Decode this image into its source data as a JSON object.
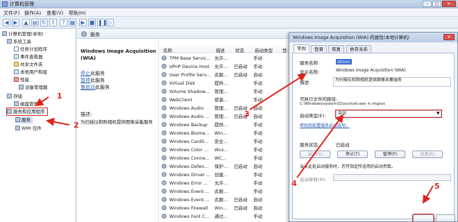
{
  "window": {
    "title": "计算机管理"
  },
  "menu": [
    "文件(F)",
    "操作(A)",
    "查看(V)",
    "帮助(H)"
  ],
  "tree": {
    "root": "计算机管理(本地)",
    "items": [
      "系统工具",
      "任务计划程序",
      "事件查看器",
      "共享文件夹",
      "本地用户和组",
      "性能",
      "设备管理器",
      "存储",
      "磁盘管理",
      "服务和应用程序",
      "服务",
      "WMI 控件"
    ]
  },
  "header": {
    "title": "服务"
  },
  "detail": {
    "service_name": "Windows Image Acquisition",
    "service_name2": "(WIA)",
    "stop_link": "停止",
    "stop_suffix": "此服务",
    "pause_link": "暂停",
    "pause_suffix": "此服务",
    "restart_link": "重启动",
    "restart_suffix": "此服务",
    "desc_label": "描述:",
    "desc_text": "为扫描仪和照相机提供图像采集服务"
  },
  "columns": {
    "name": "名称",
    "desc": "描述",
    "status": "状态",
    "startup": "启动类型",
    "logon": "登"
  },
  "services": [
    {
      "name": "TPM Base Servic...",
      "desc": "允许...",
      "status": "",
      "startup": "手动"
    },
    {
      "name": "UPnP Device Host",
      "desc": "允许...",
      "status": "已启动",
      "startup": "手动"
    },
    {
      "name": "User Profile Serv...",
      "desc": "此服...",
      "status": "已启动",
      "startup": "自动"
    },
    {
      "name": "Virtual Disk",
      "desc": "提供...",
      "status": "",
      "startup": "手动"
    },
    {
      "name": "Volume Shadow...",
      "desc": "管理...",
      "status": "",
      "startup": "手动"
    },
    {
      "name": "WebClient",
      "desc": "使基...",
      "status": "",
      "startup": "手动"
    },
    {
      "name": "Windows Audio",
      "desc": "管理...",
      "status": "已启动",
      "startup": "自动"
    },
    {
      "name": "Windows Audio ...",
      "desc": "管理...",
      "status": "已启动",
      "startup": "自动"
    },
    {
      "name": "Windows Backup",
      "desc": "提供...",
      "status": "",
      "startup": "手动"
    },
    {
      "name": "Windows Biome...",
      "desc": "Win...",
      "status": "",
      "startup": "手动"
    },
    {
      "name": "Windows CardS...",
      "desc": "安全...",
      "status": "",
      "startup": "手动"
    },
    {
      "name": "Windows Color ...",
      "desc": "Wcs...",
      "status": "",
      "startup": "手动"
    },
    {
      "name": "Windows Conne...",
      "desc": "WC...",
      "status": "",
      "startup": "手动"
    },
    {
      "name": "Windows Defen...",
      "desc": "保护...",
      "status": "已启动",
      "startup": "自动"
    },
    {
      "name": "Windows Driver ...",
      "desc": "创建...",
      "status": "",
      "startup": "手动"
    },
    {
      "name": "Windows Error ...",
      "desc": "允许...",
      "status": "",
      "startup": "手动"
    },
    {
      "name": "Windows Event ...",
      "desc": "此服...",
      "status": "",
      "startup": "手动"
    },
    {
      "name": "Windows Event ...",
      "desc": "此服...",
      "status": "已启动",
      "startup": "自动"
    },
    {
      "name": "Windows Firewall",
      "desc": "Win...",
      "status": "已启动",
      "startup": "自动"
    },
    {
      "name": "Windows Font C...",
      "desc": "通过...",
      "status": "",
      "startup": "手动"
    }
  ],
  "dialog": {
    "title": "Windows Image Acquisition (WIA) 的属性(本地计算机)",
    "tabs": [
      "常规",
      "登录",
      "恢复",
      "依存关系"
    ],
    "service_name_label": "服务名称:",
    "service_name_value": "stisvc",
    "display_name_label": "显示名称:",
    "display_name_value": "Windows Image Acquisition (WIA)",
    "desc_label": "描述:",
    "desc_value": "为扫描仪和照相机提供图像采集服务",
    "path_label": "可执行文件的路径:",
    "path_value": "C:\\Windows\\system32\\svchost.exe -k imgsvc",
    "startup_label": "启动类型(E):",
    "startup_value": "自动",
    "help_link": "帮助我配置服务启动选项。",
    "status_label": "服务状态:",
    "status_value": "已启动",
    "btn_start": "启动(S)",
    "btn_stop": "停止(T)",
    "btn_pause": "暂停(P)",
    "btn_resume": "恢复(R)",
    "hint": "当从此处启动服务时，您可指定所适用的启动参数。",
    "param_label": "启动参数(M):"
  },
  "callouts": [
    "1",
    "2",
    "3",
    "4",
    "5"
  ],
  "colors": {
    "annotation": "#e0241b",
    "link": "#2a5db0",
    "titlebar": "#bccde6"
  }
}
